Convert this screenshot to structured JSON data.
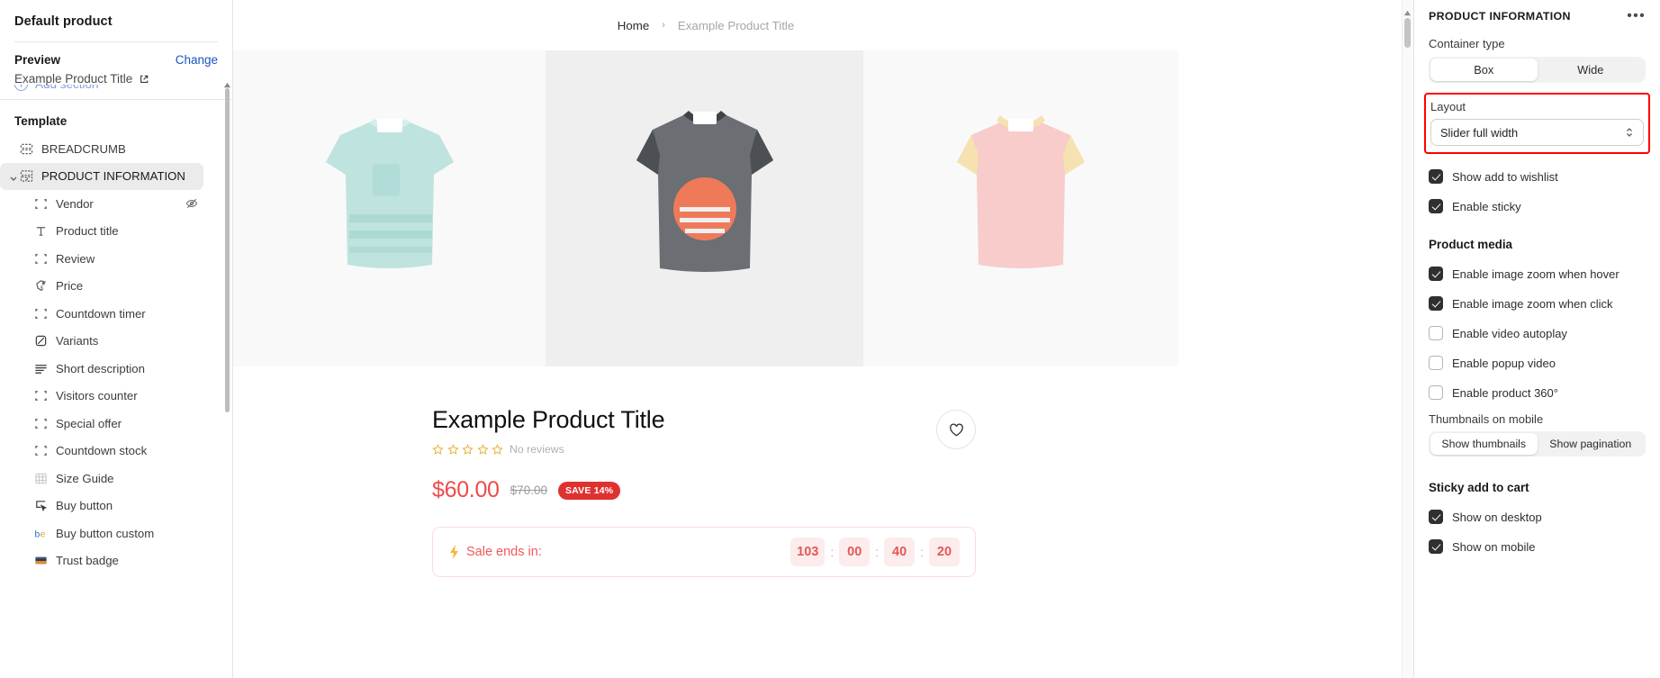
{
  "sidebar": {
    "title": "Default product",
    "preview": {
      "label": "Preview",
      "change_label": "Change",
      "product_name": "Example Product Title",
      "external_icon": "external-link-icon"
    },
    "add_section_label": "Add section",
    "template_label": "Template",
    "items": [
      {
        "label": "BREADCRUMB",
        "icon": "section-block-icon",
        "level": "top",
        "active": false,
        "hidden": false
      },
      {
        "label": "PRODUCT INFORMATION",
        "icon": "section-group-icon",
        "level": "top",
        "active": true,
        "hidden": false
      },
      {
        "label": "Vendor",
        "icon": "placeholder-block-icon",
        "level": "sub",
        "active": false,
        "hidden": true
      },
      {
        "label": "Product title",
        "icon": "text-icon",
        "level": "sub",
        "active": false,
        "hidden": false
      },
      {
        "label": "Review",
        "icon": "placeholder-block-icon",
        "level": "sub",
        "active": false,
        "hidden": false
      },
      {
        "label": "Price",
        "icon": "price-tag-icon",
        "level": "sub",
        "active": false,
        "hidden": false
      },
      {
        "label": "Countdown timer",
        "icon": "placeholder-block-icon",
        "level": "sub",
        "active": false,
        "hidden": false
      },
      {
        "label": "Variants",
        "icon": "variants-icon",
        "level": "sub",
        "active": false,
        "hidden": false
      },
      {
        "label": "Short description",
        "icon": "text-lines-icon",
        "level": "sub",
        "active": false,
        "hidden": false
      },
      {
        "label": "Visitors counter",
        "icon": "placeholder-block-icon",
        "level": "sub",
        "active": false,
        "hidden": false
      },
      {
        "label": "Special offer",
        "icon": "placeholder-block-icon",
        "level": "sub",
        "active": false,
        "hidden": false
      },
      {
        "label": "Countdown stock",
        "icon": "placeholder-block-icon",
        "level": "sub",
        "active": false,
        "hidden": false
      },
      {
        "label": "Size Guide",
        "icon": "size-guide-icon",
        "level": "sub",
        "active": false,
        "hidden": false
      },
      {
        "label": "Buy button",
        "icon": "buy-button-icon",
        "level": "sub",
        "active": false,
        "hidden": false
      },
      {
        "label": "Buy button custom",
        "icon": "buy-button-custom-icon",
        "level": "sub",
        "active": false,
        "hidden": false
      },
      {
        "label": "Trust badge",
        "icon": "trust-badge-icon",
        "level": "sub",
        "active": false,
        "hidden": false
      }
    ]
  },
  "preview": {
    "breadcrumb": {
      "home": "Home",
      "separator": "›",
      "current": "Example Product Title"
    },
    "product": {
      "title": "Example Product Title",
      "stars": 5,
      "reviews_text": "No reviews",
      "price": "$60.00",
      "compare_at_price": "$70.00",
      "save_badge": "SAVE 14%",
      "wishlist_icon": "heart-icon"
    },
    "countdown": {
      "bolt_icon": "lightning-bolt-icon",
      "label": "Sale ends in:",
      "units": [
        "103",
        "00",
        "40",
        "20"
      ],
      "separator": ":"
    }
  },
  "panel": {
    "title": "PRODUCT INFORMATION",
    "more_icon": "ellipsis-icon",
    "container_type": {
      "label": "Container type",
      "options": [
        "Box",
        "Wide"
      ],
      "selected": "Box"
    },
    "layout": {
      "label": "Layout",
      "value": "Slider full width",
      "highlighted": true,
      "highlight_color": "#ff0000"
    },
    "toggles_primary": [
      {
        "label": "Show add to wishlist",
        "checked": true
      },
      {
        "label": "Enable sticky",
        "checked": true
      }
    ],
    "product_media": {
      "heading": "Product media",
      "toggles": [
        {
          "label": "Enable image zoom when hover",
          "checked": true
        },
        {
          "label": "Enable image zoom when click",
          "checked": true
        },
        {
          "label": "Enable video autoplay",
          "checked": false
        },
        {
          "label": "Enable popup video",
          "checked": false
        },
        {
          "label": "Enable product 360°",
          "checked": false
        }
      ],
      "thumbnails_on_mobile": {
        "label": "Thumbnails on mobile",
        "options": [
          "Show thumbnails",
          "Show pagination"
        ],
        "selected": "Show thumbnails"
      }
    },
    "sticky_add_to_cart": {
      "heading": "Sticky add to cart",
      "toggles": [
        {
          "label": "Show on desktop",
          "checked": true
        },
        {
          "label": "Show on mobile",
          "checked": true
        }
      ]
    }
  },
  "colors": {
    "accent_link": "#1753c4",
    "price": "#ef4a4a",
    "badge": "#e03131",
    "highlight": "#ff0000",
    "star": "#e8b23c"
  }
}
